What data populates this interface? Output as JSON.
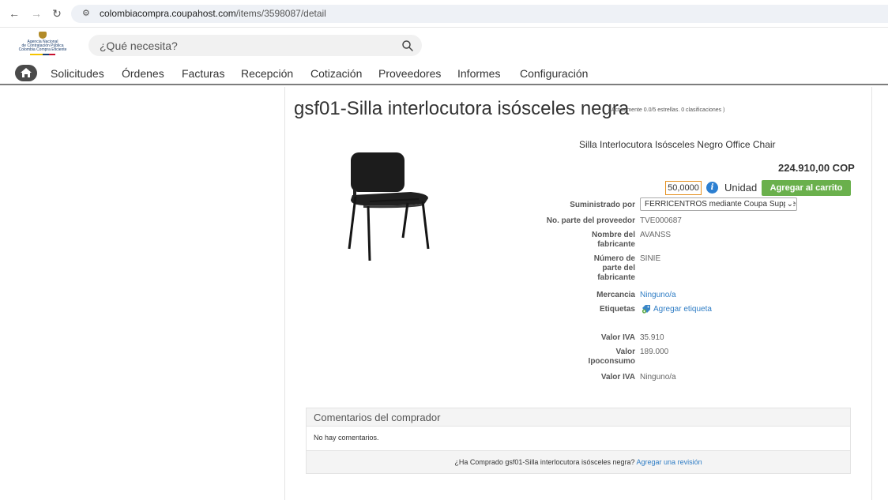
{
  "browser": {
    "url_domain": "colombiacompra.coupahost.com",
    "url_path": "/items/3598087/detail"
  },
  "logo": {
    "line1": "Agencia Nacional",
    "line2": "de Contratación Pública",
    "line3": "Colombia Compra Eficiente"
  },
  "search": {
    "placeholder": "¿Qué necesita?"
  },
  "menu": {
    "items": [
      "Solicitudes",
      "Órdenes",
      "Facturas",
      "Recepción",
      "Cotización",
      "Proveedores",
      "Informes",
      "Configuración"
    ]
  },
  "item": {
    "title": "gsf01-Silla interlocutora isósceles negra",
    "rating": "( Actualmente 0.0/5 estrellas. 0 clasificaciones )",
    "description": "Silla Interlocutora Isósceles Negro Office Chair",
    "price": "224.910,00 COP",
    "quantity": "50,0000",
    "unit": "Unidad",
    "add_to_cart": "Agregar al carrito"
  },
  "details": {
    "supplied_by_label": "Suministrado por",
    "supplied_by_value": "FERRICENTROS mediante Coupa Supplier",
    "supplier_part_label": "No. parte del proveedor",
    "supplier_part_value": "TVE000687",
    "manufacturer_label_1": "Nombre del",
    "manufacturer_label_2": "fabricante",
    "manufacturer_value": "AVANSS",
    "mfr_part_label_1": "Número de",
    "mfr_part_label_2": "parte del",
    "mfr_part_label_3": "fabricante",
    "mfr_part_value": "SINIE",
    "commodity_label": "Mercancia",
    "commodity_value": "Ninguno/a",
    "tags_label": "Etiquetas",
    "tags_value": "Agregar etiqueta",
    "iva_label": "Valor IVA",
    "iva_value": "35.910",
    "ipoconsumo_label_1": "Valor",
    "ipoconsumo_label_2": "Ipoconsumo",
    "ipoconsumo_value": "189.000",
    "iva2_label": "Valor IVA",
    "iva2_value": "Ninguno/a"
  },
  "comments": {
    "title": "Comentarios del comprador",
    "empty": "No hay comentarios.",
    "question": "¿Ha Comprado gsf01-Silla interlocutora isósceles negra?",
    "review_link": "Agregar una revisión"
  },
  "colors": {
    "accent_button": "#6ab04c",
    "link": "#2f7dc5",
    "qty_border": "#e4901f",
    "info": "#2c7fd1"
  }
}
